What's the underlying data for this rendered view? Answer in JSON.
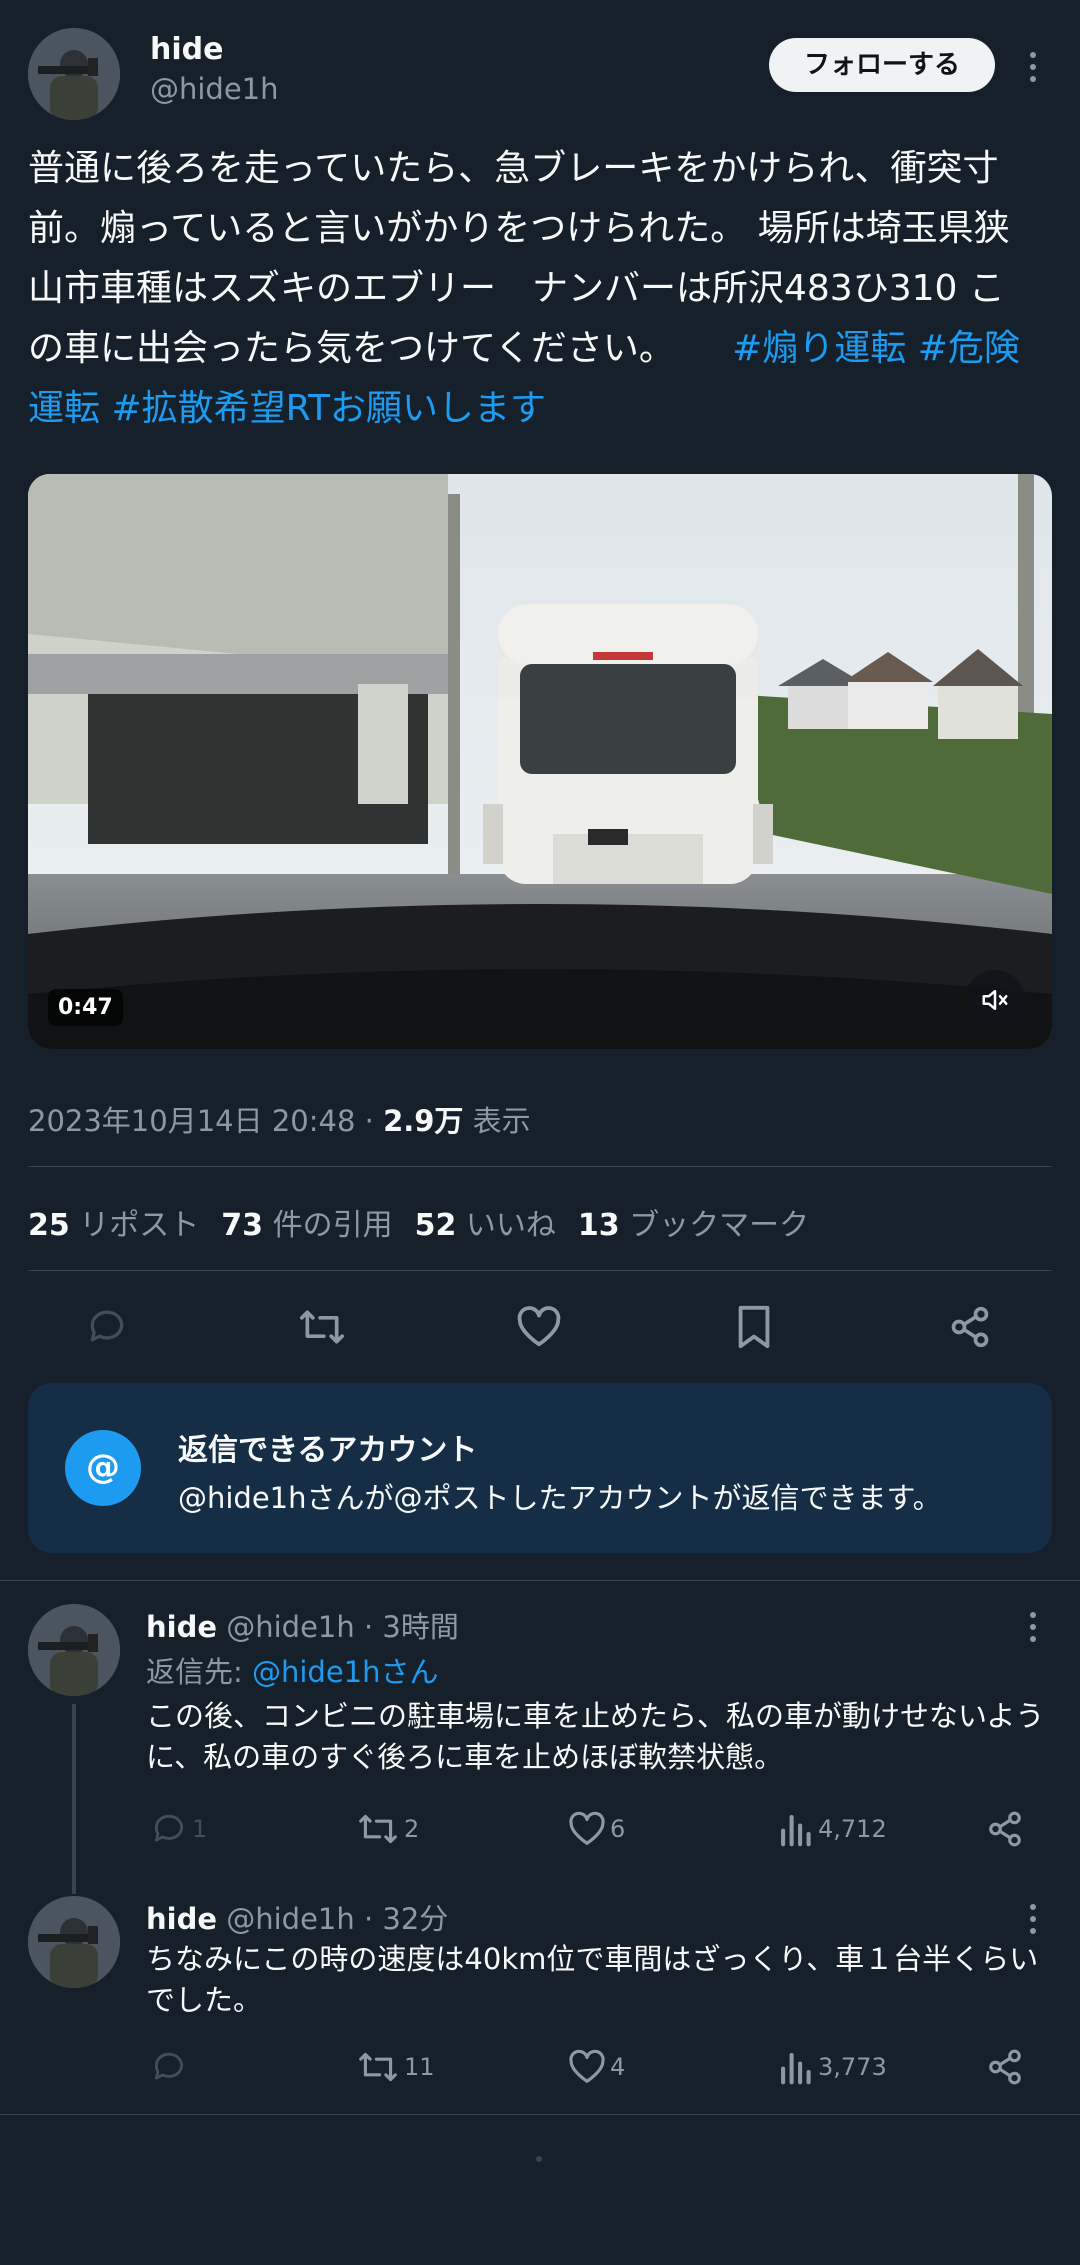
{
  "tweet": {
    "author_name": "hide",
    "author_handle": "@hide1h",
    "follow_label": "フォローする",
    "text": "普通に後ろを走っていたら、急ブレーキをかけられ、衝突寸前。煽っていると言いがかりをつけられた。 場所は埼玉県狭山市車種はスズキのエブリー　ナンバーは所沢483ひ310 この車に出会ったら気をつけてください。",
    "hashtags": [
      "#煽り運転",
      "#危険運転",
      "#拡散希望RTお願いします"
    ],
    "video_duration": "0:47",
    "timestamp": "2023年10月14日 20:48 · ",
    "views_count": "2.9万",
    "views_label": "表示",
    "stats": [
      {
        "count": "25",
        "label": "リポスト"
      },
      {
        "count": "73",
        "label": "件の引用"
      },
      {
        "count": "52",
        "label": "いいね"
      },
      {
        "count": "13",
        "label": "ブックマーク"
      }
    ]
  },
  "reply_notice": {
    "title": "返信できるアカウント",
    "body": "@hide1hさんが@ポストしたアカウントが返信できます。",
    "icon_char": "@"
  },
  "replies": [
    {
      "name": "hide",
      "meta": "@hide1h · 3時間",
      "reply_to_prefix": "返信先: ",
      "reply_to_handle": "@hide1hさん",
      "text": "この後、コンビニの駐車場に車を止めたら、私の車が動けせないように、私の車のすぐ後ろに車を止めほぼ軟禁状態。",
      "counts": {
        "reply": "1",
        "retweet": "2",
        "like": "6",
        "views": "4,712"
      }
    },
    {
      "name": "hide",
      "meta": "@hide1h · 32分",
      "text": "ちなみにこの時の速度は40km位で車間はざっくり、車１台半くらいでした。",
      "counts": {
        "reply": "",
        "retweet": "11",
        "like": "4",
        "views": "3,773"
      }
    }
  ],
  "colors": {
    "accent": "#1d9bf0",
    "background": "#15202b",
    "notice_bg": "#152e45"
  }
}
